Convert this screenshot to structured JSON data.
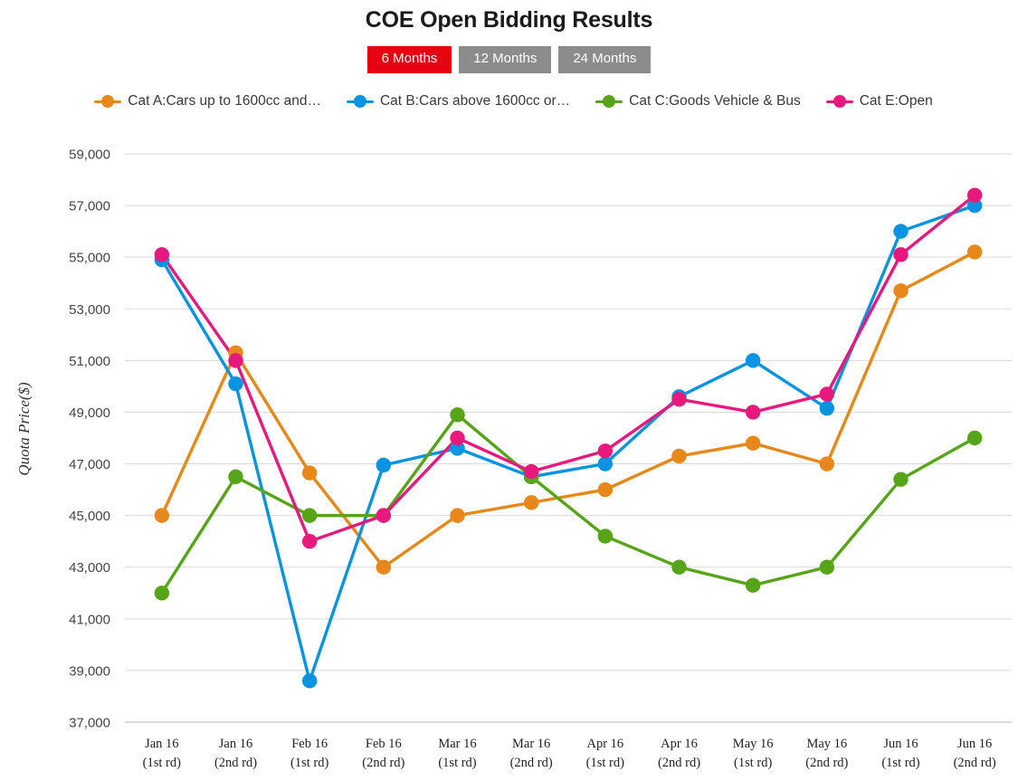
{
  "header": {
    "title": "COE Open Bidding Results"
  },
  "range_toggle": {
    "options": [
      {
        "label": "6 Months",
        "active": true
      },
      {
        "label": "12 Months",
        "active": false
      },
      {
        "label": "24 Months",
        "active": false
      }
    ],
    "active_color": "#e60012",
    "inactive_color": "#8c8c8c"
  },
  "chart_data": {
    "type": "line",
    "title": "COE Open Bidding Results",
    "xlabel": "",
    "ylabel": "Quota Price($)",
    "ylim": [
      37000,
      59000
    ],
    "ytick_step": 2000,
    "yticks": [
      "37,000",
      "39,000",
      "41,000",
      "43,000",
      "45,000",
      "47,000",
      "49,000",
      "51,000",
      "53,000",
      "55,000",
      "57,000",
      "59,000"
    ],
    "grid": true,
    "legend_position": "top",
    "categories": [
      "Jan 16\n(1st rd)",
      "Jan 16\n(2nd rd)",
      "Feb 16\n(1st rd)",
      "Feb 16\n(2nd rd)",
      "Mar 16\n(1st rd)",
      "Mar 16\n(2nd rd)",
      "Apr 16\n(1st rd)",
      "Apr 16\n(2nd rd)",
      "May 16\n(1st rd)",
      "May 16\n(2nd rd)",
      "Jun 16\n(1st rd)",
      "Jun 16\n(2nd rd)"
    ],
    "categories_lines": [
      [
        "Jan 16",
        "(1st rd)"
      ],
      [
        "Jan 16",
        "(2nd rd)"
      ],
      [
        "Feb 16",
        "(1st rd)"
      ],
      [
        "Feb 16",
        "(2nd rd)"
      ],
      [
        "Mar 16",
        "(1st rd)"
      ],
      [
        "Mar 16",
        "(2nd rd)"
      ],
      [
        "Apr 16",
        "(1st rd)"
      ],
      [
        "Apr 16",
        "(2nd rd)"
      ],
      [
        "May 16",
        "(1st rd)"
      ],
      [
        "May 16",
        "(2nd rd)"
      ],
      [
        "Jun 16",
        "(1st rd)"
      ],
      [
        "Jun 16",
        "(2nd rd)"
      ]
    ],
    "series": [
      {
        "name": "Cat A:Cars up to 1600cc and…",
        "color": "#e8871a",
        "values": [
          45000,
          51300,
          46650,
          43000,
          45000,
          45500,
          46000,
          47300,
          47800,
          47000,
          53700,
          55200
        ]
      },
      {
        "name": "Cat B:Cars above 1600cc or…",
        "color": "#0a93e0",
        "values": [
          54900,
          50100,
          38600,
          46950,
          47600,
          46500,
          47000,
          49600,
          51000,
          49150,
          56000,
          57000
        ]
      },
      {
        "name": "Cat C:Goods Vehicle & Bus",
        "color": "#56a518",
        "values": [
          42000,
          46500,
          45000,
          45000,
          48900,
          46500,
          44200,
          43000,
          42300,
          43000,
          46400,
          48000
        ]
      },
      {
        "name": "Cat E:Open",
        "color": "#e8197d",
        "values": [
          55100,
          51000,
          44000,
          45000,
          48000,
          46700,
          47500,
          49500,
          49000,
          49700,
          55100,
          57400
        ]
      }
    ]
  }
}
